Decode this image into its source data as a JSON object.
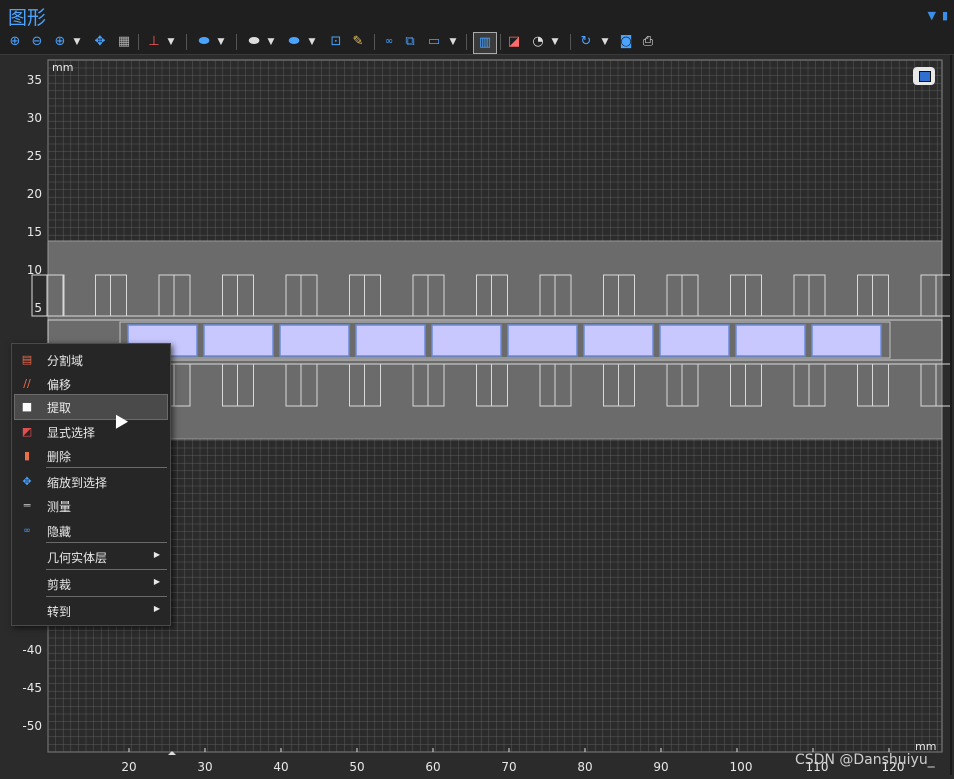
{
  "window": {
    "title": "图形"
  },
  "toolbar": {
    "icons": [
      "zoom-in-icon",
      "zoom-out-icon",
      "zoom-box-icon",
      "zoom-extents-icon",
      "zoom-selection-icon",
      "axis-icon",
      "select-domains-icon",
      "select-boundaries-icon",
      "select-edges-icon",
      "select-box-icon",
      "paint-selection-icon",
      "hide-icon",
      "show-icon",
      "views-icon",
      "wireframe-icon",
      "transparency-icon",
      "scene-light-icon",
      "refresh-icon",
      "camera-icon",
      "print-icon"
    ]
  },
  "plot": {
    "unit_top": "mm",
    "unit_bottom": "mm",
    "y_ticks_upper": [
      "35",
      "30",
      "25",
      "20",
      "15",
      "10",
      "5"
    ],
    "y_ticks_lower": [
      "-40",
      "-45",
      "-50"
    ],
    "x_ticks": [
      "20",
      "30",
      "40",
      "50",
      "60",
      "70",
      "80",
      "90",
      "100",
      "110",
      "120"
    ],
    "colors": {
      "background": "#2b2b2b",
      "grid": "#6e6e6e",
      "band": "#6b6b6b",
      "selected_domain": "#c8c8ff"
    }
  },
  "context_menu": {
    "items": [
      {
        "label": "分割域",
        "icon": "partition-domain-icon"
      },
      {
        "label": "偏移",
        "icon": "offset-icon"
      },
      {
        "label": "提取",
        "icon": "extract-icon"
      },
      {
        "label": "显式选择",
        "icon": "explicit-selection-icon"
      },
      {
        "label": "删除",
        "icon": "delete-icon"
      },
      {
        "label": "缩放到选择",
        "icon": "zoom-to-selection-icon"
      },
      {
        "label": "测量",
        "icon": "measure-icon"
      },
      {
        "label": "隐藏",
        "icon": "hide-icon"
      },
      {
        "label": "几何实体层",
        "icon": ""
      },
      {
        "label": "剪裁",
        "icon": ""
      },
      {
        "label": "转到",
        "icon": ""
      }
    ]
  },
  "watermark": "CSDN @Danshuiyu_"
}
